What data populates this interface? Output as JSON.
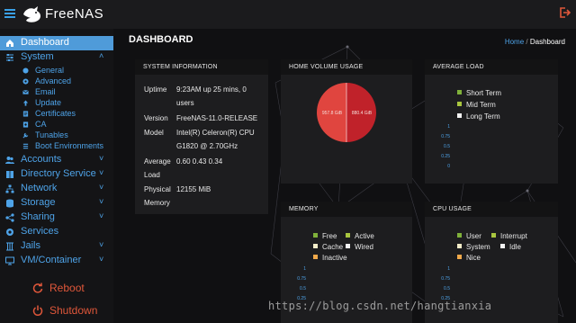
{
  "app": {
    "brand": "FreeNAS"
  },
  "sidebar": {
    "dashboard": "Dashboard",
    "system": "System",
    "system_sub": [
      "General",
      "Advanced",
      "Email",
      "Update",
      "Certificates",
      "CA",
      "Tunables",
      "Boot Environments"
    ],
    "accounts": "Accounts",
    "directory": "Directory Service",
    "network": "Network",
    "storage": "Storage",
    "sharing": "Sharing",
    "services": "Services",
    "jails": "Jails",
    "vm": "VM/Container",
    "reboot": "Reboot",
    "shutdown": "Shutdown"
  },
  "page": {
    "title": "DASHBOARD",
    "breadcrumb_home": "Home",
    "breadcrumb_sep": "/",
    "breadcrumb_current": "Dashboard"
  },
  "system_info": {
    "title": "SYSTEM INFORMATION",
    "uptime_label": "Uptime",
    "uptime_value_1": "9:23AM up 25 mins, 0",
    "uptime_value_2": "users",
    "version_label": "Version",
    "version_value": "FreeNAS-11.0-RELEASE",
    "model_label": "Model",
    "model_value_1": "Intel(R) Celeron(R) CPU",
    "model_value_2": "G1820 @ 2.70GHz",
    "average_label_1": "Average",
    "average_label_2": "Load",
    "average_value": "0.60 0.43 0.34",
    "physical_label_1": "Physical",
    "physical_label_2": "Memory",
    "physical_value": "12155 MiB"
  },
  "home_volume": {
    "title": "HOME VOLUME USAGE",
    "slice_left_label": "957.8 GiB",
    "slice_right_label": "880.4 GiB",
    "colors": {
      "left": "#e0453f",
      "right": "#c0222a"
    }
  },
  "average_load": {
    "title": "AVERAGE LOAD",
    "legend": [
      {
        "label": "Short Term",
        "color": "#7fb13a"
      },
      {
        "label": "Mid Term",
        "color": "#a9c63f"
      },
      {
        "label": "Long Term",
        "color": "#f2f2f2"
      }
    ],
    "ticks": [
      "1",
      "0.75",
      "0.5",
      "0.25",
      "0"
    ]
  },
  "memory": {
    "title": "MEMORY",
    "legend": [
      {
        "label": "Free",
        "color": "#7fb13a"
      },
      {
        "label": "Active",
        "color": "#a9c63f"
      },
      {
        "label": "Cache",
        "color": "#f2ecc8"
      },
      {
        "label": "Wired",
        "color": "#f2f2f2"
      },
      {
        "label": "Inactive",
        "color": "#f0a94a"
      }
    ],
    "ticks": [
      "1",
      "0.75",
      "0.5",
      "0.25"
    ]
  },
  "cpu": {
    "title": "CPU USAGE",
    "legend": [
      {
        "label": "User",
        "color": "#7fb13a"
      },
      {
        "label": "Interrupt",
        "color": "#a9c63f"
      },
      {
        "label": "System",
        "color": "#f2ecc8"
      },
      {
        "label": "Idle",
        "color": "#f2f2f2"
      },
      {
        "label": "Nice",
        "color": "#f0a94a"
      }
    ],
    "ticks": [
      "1",
      "0.75",
      "0.5",
      "0.25"
    ]
  },
  "watermark": "https://blog.csdn.net/hangtianxia",
  "colors": {
    "accent": "#4ea3e8",
    "active_nav": "#4f9bd9",
    "danger": "#e0573a"
  }
}
